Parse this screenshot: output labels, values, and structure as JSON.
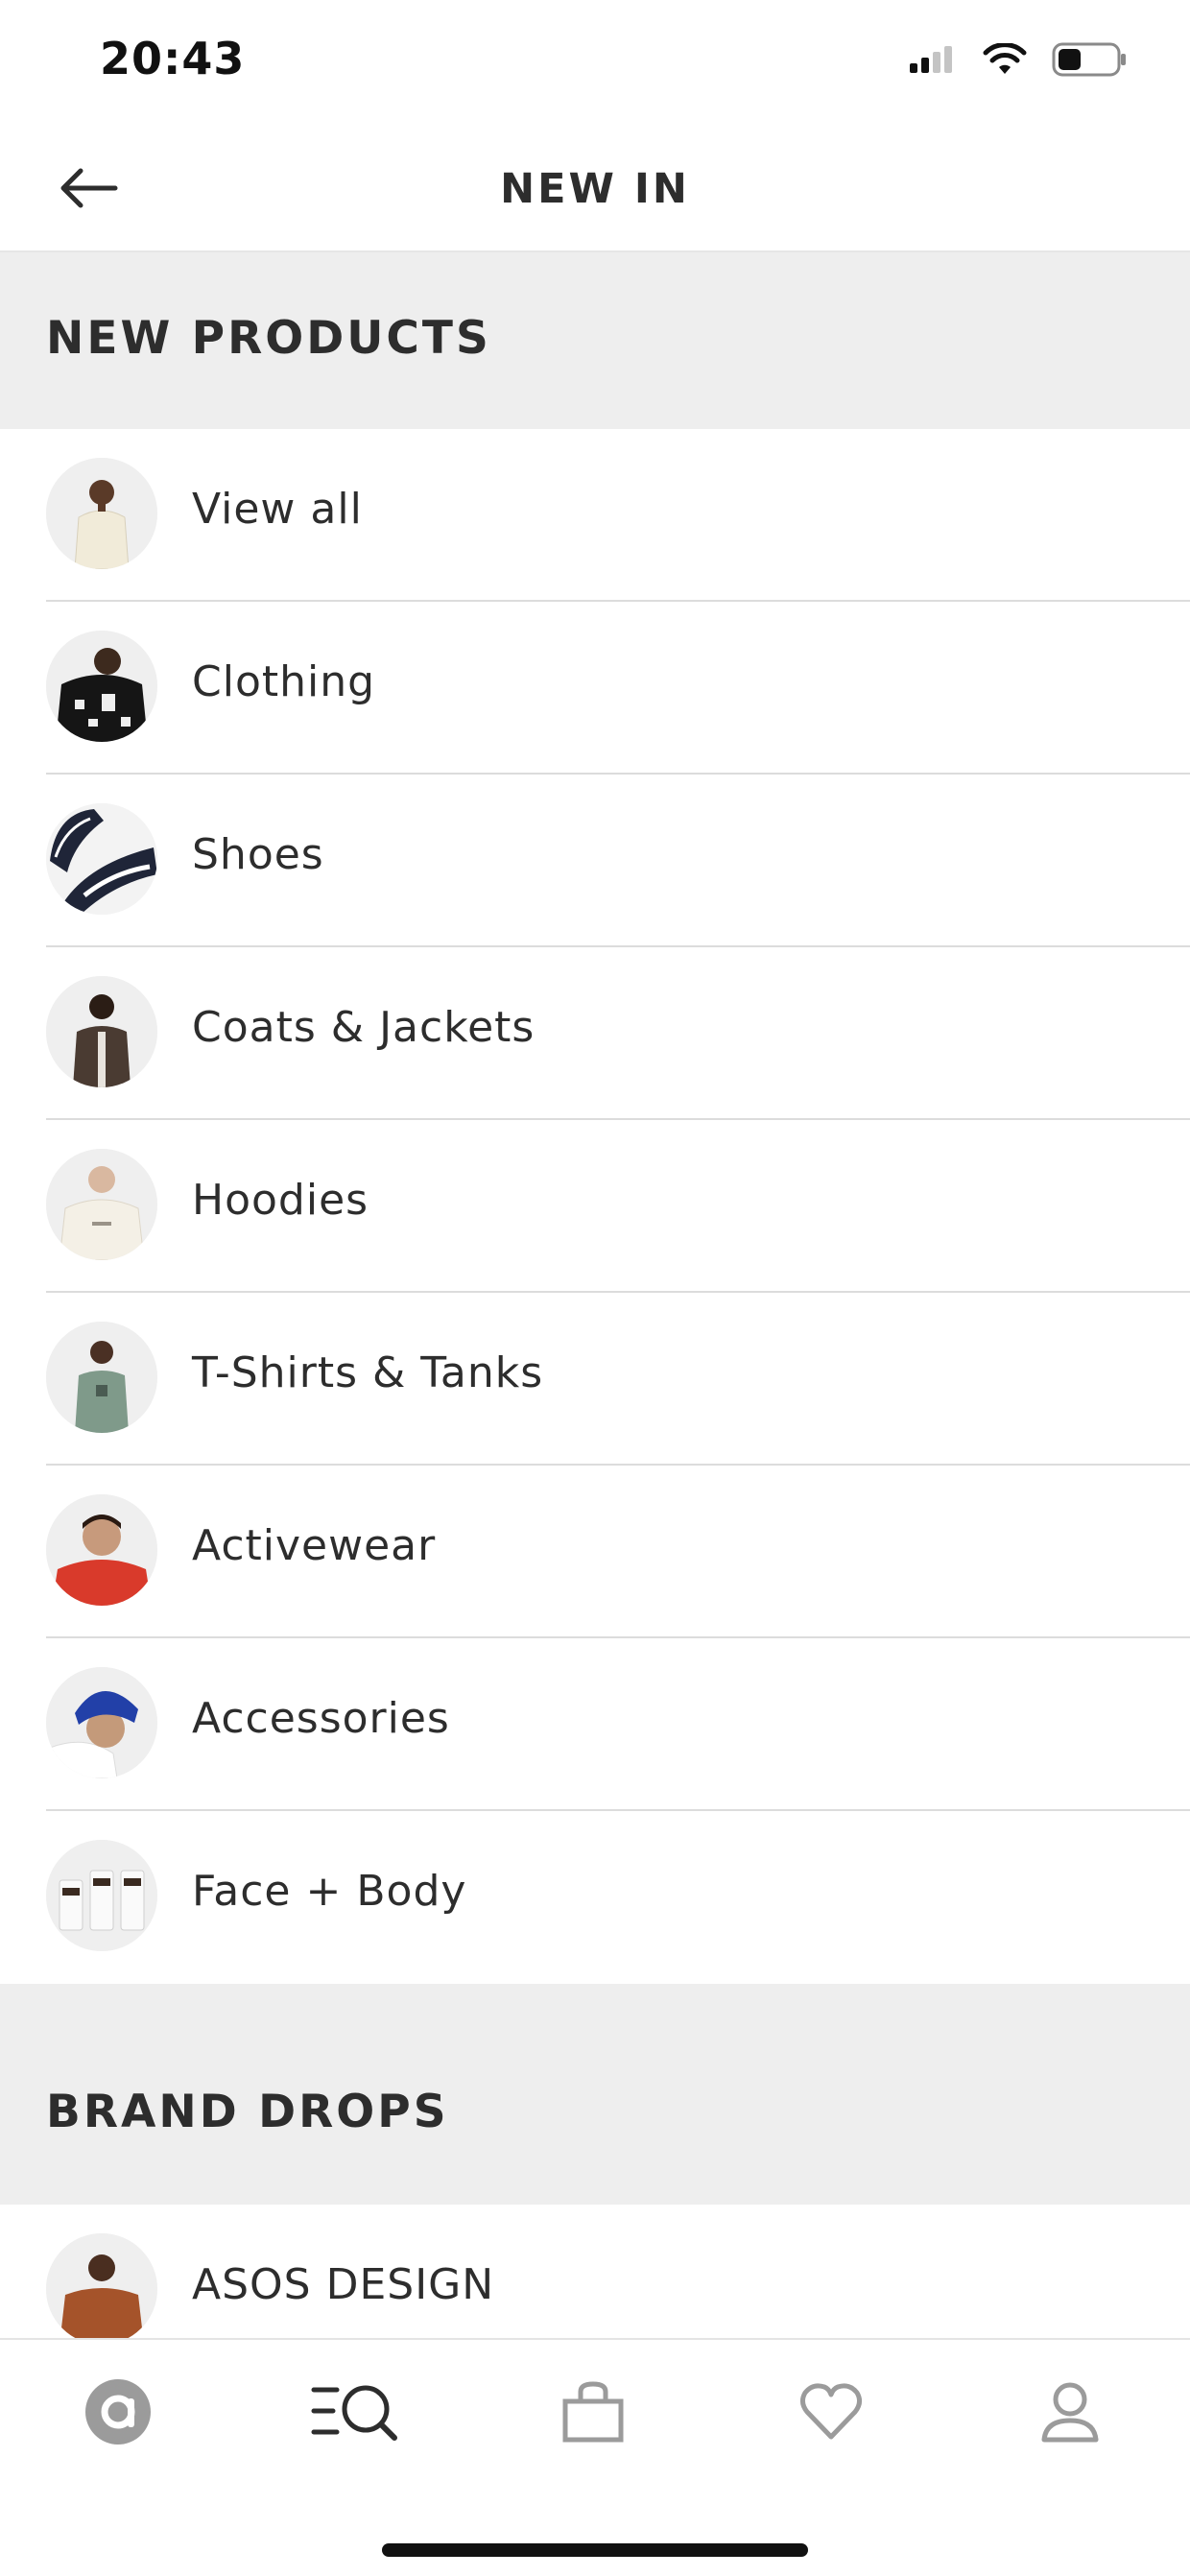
{
  "status_bar": {
    "time": "20:43",
    "battery_level": 0.4
  },
  "header": {
    "title": "NEW IN",
    "back_icon": "arrow-left-icon"
  },
  "sections": {
    "new_products": {
      "title": "NEW PRODUCTS"
    },
    "brand_drops": {
      "title": "BRAND DROPS"
    }
  },
  "new_products_items": [
    {
      "label": "View all",
      "thumb": "man-cream-jacket-thumb"
    },
    {
      "label": "Clothing",
      "thumb": "man-black-print-hoodie-thumb"
    },
    {
      "label": "Shoes",
      "thumb": "navy-sneakers-thumb"
    },
    {
      "label": "Coats & Jackets",
      "thumb": "man-brown-jacket-thumb"
    },
    {
      "label": "Hoodies",
      "thumb": "man-cream-hoodie-thumb"
    },
    {
      "label": "T-Shirts & Tanks",
      "thumb": "man-green-tshirt-thumb"
    },
    {
      "label": "Activewear",
      "thumb": "man-red-top-thumb"
    },
    {
      "label": "Accessories",
      "thumb": "blue-beanie-thumb"
    },
    {
      "label": "Face + Body",
      "thumb": "bulldog-skincare-thumb"
    }
  ],
  "brand_drops_items": [
    {
      "label": "ASOS DESIGN",
      "thumb": "man-rust-knit-thumb"
    }
  ],
  "tab_bar": [
    {
      "name": "home",
      "icon": "asos-logo-icon"
    },
    {
      "name": "search",
      "icon": "search-menu-icon",
      "active": true
    },
    {
      "name": "bag",
      "icon": "shopping-bag-icon"
    },
    {
      "name": "saved",
      "icon": "heart-icon"
    },
    {
      "name": "account",
      "icon": "user-icon"
    }
  ],
  "colors": {
    "text": "#2d2d2d",
    "section_bg": "#eeeeee",
    "divider": "#dcdcdc",
    "tab_inactive": "#9b9b9b",
    "tab_active": "#2d2d2d"
  }
}
